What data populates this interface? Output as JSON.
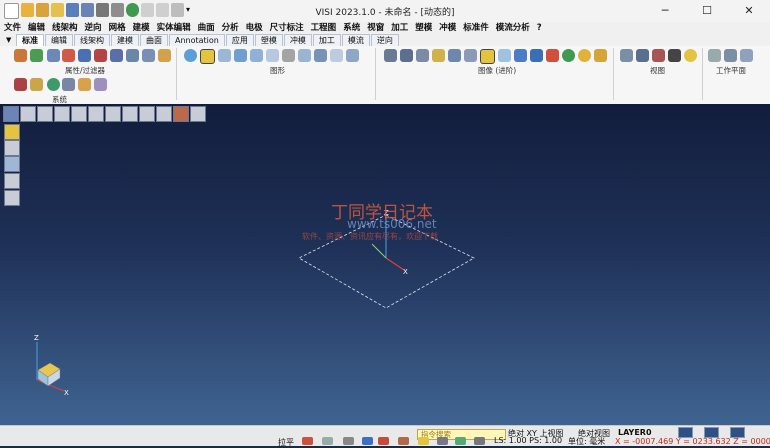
{
  "window": {
    "title": "VISI 2023.1.0 - 未命名 - [动态的]",
    "minimize": "─",
    "maximize": "☐",
    "close": "✕"
  },
  "menu": [
    "文件",
    "编辑",
    "线架构",
    "逆向",
    "网格",
    "建模",
    "实体编辑",
    "曲面",
    "分析",
    "电极",
    "尺寸标注",
    "工程图",
    "系统",
    "视窗",
    "加工",
    "塑模",
    "冲模",
    "标准件",
    "模流分析",
    "?"
  ],
  "tabs": [
    "标准",
    "编辑",
    "线架构",
    "建模",
    "曲面",
    "Annotation",
    "应用",
    "塑模",
    "冲模",
    "加工",
    "模流",
    "逆向"
  ],
  "ribbon_groups": {
    "attributes": "属性/过滤器",
    "shapes": "图形",
    "images": "图像 (进阶)",
    "view": "视图",
    "workplane": "工作平面",
    "system": "系统"
  },
  "watermark": {
    "title": "丁同学日记本",
    "url": "www.ts006.net",
    "slogan": "软件、资源、资讯应有尽有，欢迎下载"
  },
  "status": {
    "cmd_placeholder": "指令搜索",
    "view1": "绝对 XY 上视图",
    "view2": "绝对视图",
    "layer": "LAYER0",
    "mode": "拉平",
    "ls_ps": "LS: 1.00 PS: 1.00",
    "unit": "单位: 毫米",
    "coords": "X = -0007.469 Y = 0233.632 Z = 0000.000"
  },
  "colors": {
    "viewport_top": "#121d3c",
    "viewport_bottom": "#3f6491",
    "coords_text": "#c0281e"
  }
}
